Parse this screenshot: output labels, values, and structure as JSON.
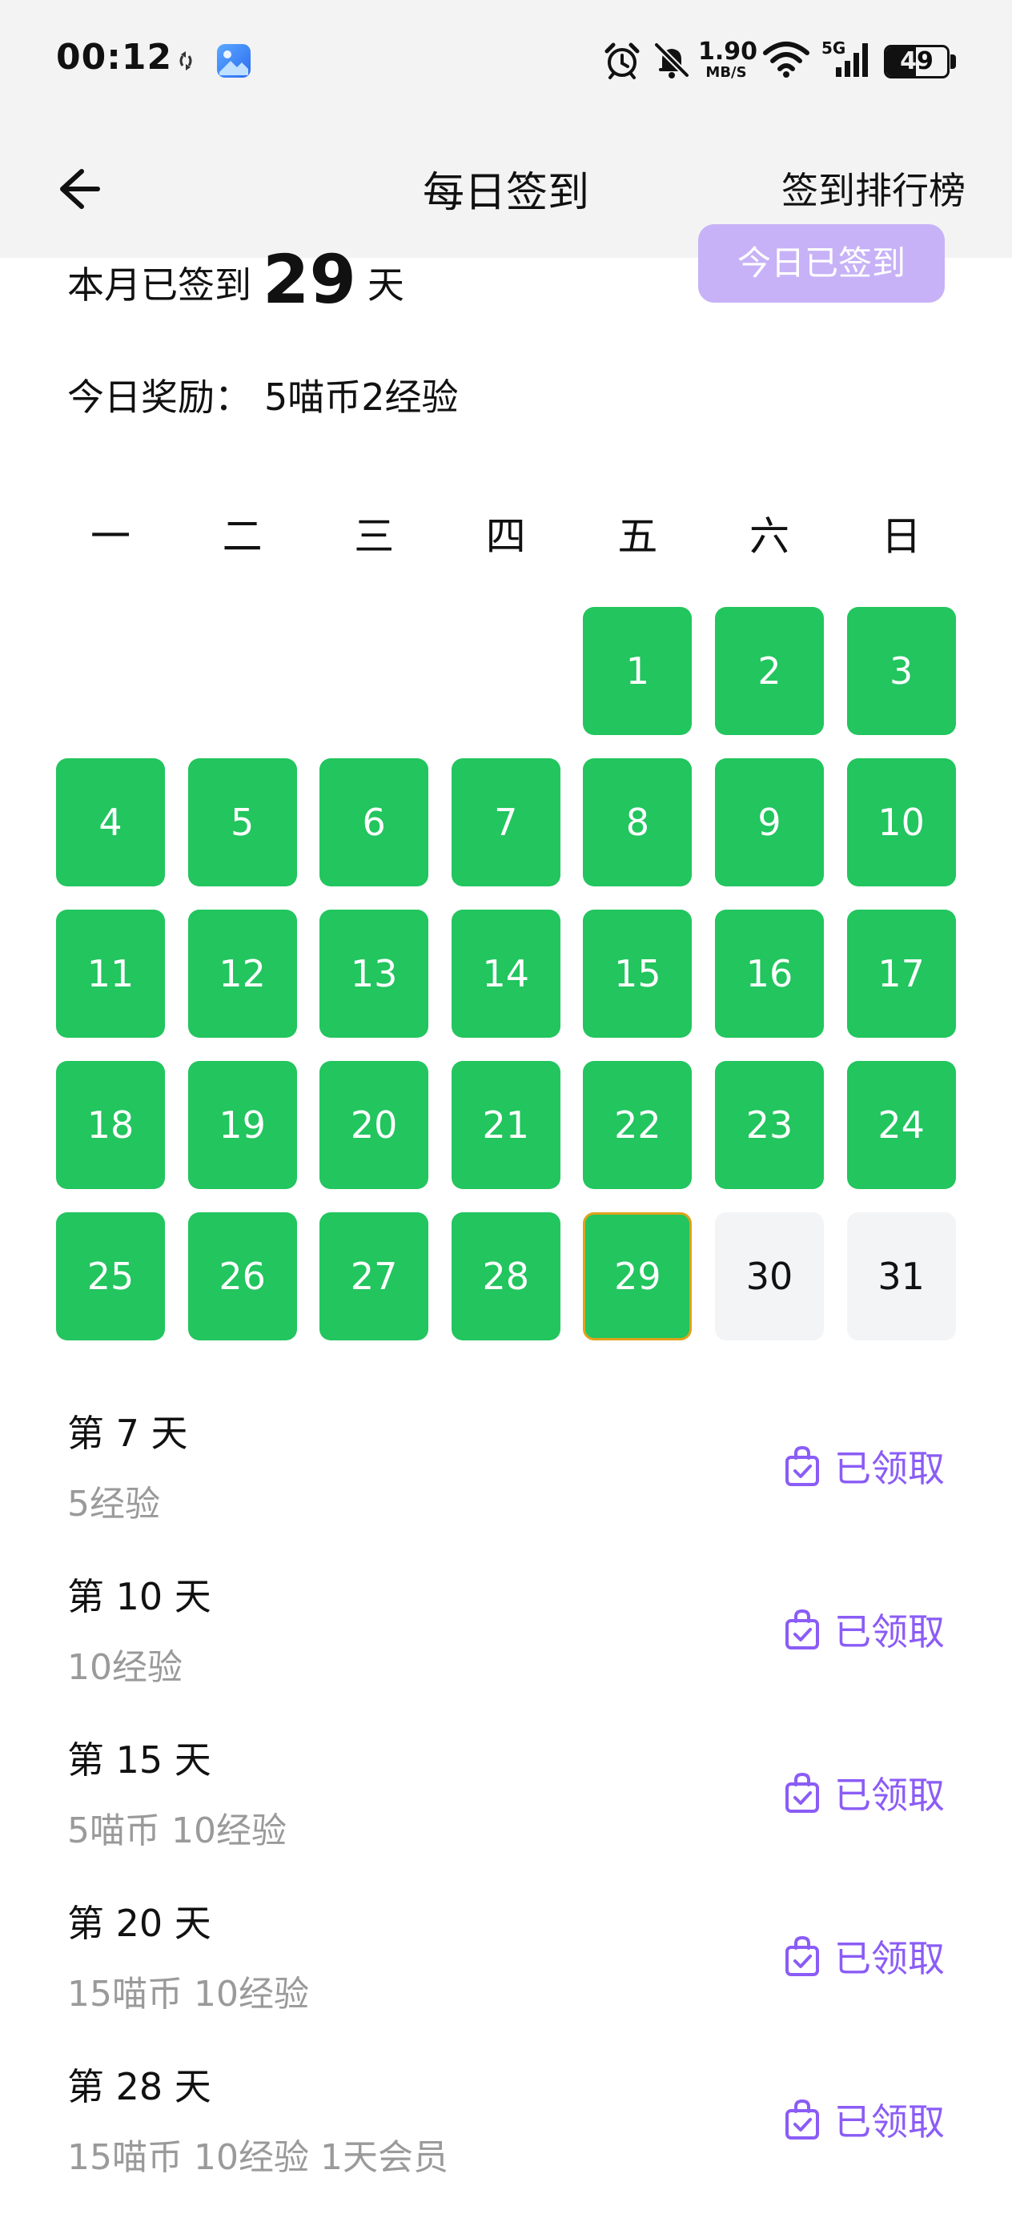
{
  "status_bar": {
    "time": "00:12",
    "net_speed_value": "1.90",
    "net_speed_unit": "MB/S",
    "network_type": "5G",
    "battery": "49",
    "battery_level": 0.49
  },
  "header": {
    "title": "每日签到",
    "ranking_label": "签到排行榜"
  },
  "summary": {
    "prefix": "本月已签到",
    "count": "29",
    "suffix": "天",
    "sign_button_label": "今日已签到",
    "reward_label": "今日奖励：",
    "reward_value": "5喵币2经验"
  },
  "calendar": {
    "weekdays": [
      "一",
      "二",
      "三",
      "四",
      "五",
      "六",
      "日"
    ],
    "first_weekday_index": 4,
    "days_in_month": 31,
    "signed_through": 29,
    "today": 29
  },
  "rewards": [
    {
      "day": "第 7 天",
      "desc": "5经验",
      "status": "已领取"
    },
    {
      "day": "第 10 天",
      "desc": "10经验",
      "status": "已领取"
    },
    {
      "day": "第 15 天",
      "desc": "5喵币 10经验",
      "status": "已领取"
    },
    {
      "day": "第 20 天",
      "desc": "15喵币 10经验",
      "status": "已领取"
    },
    {
      "day": "第 28 天",
      "desc": "15喵币 10经验 1天会员",
      "status": "已领取"
    }
  ],
  "colors": {
    "signed": "#22c55e",
    "future": "#f3f4f6",
    "today_border": "#e0a21a",
    "accent": "#8b5cf6",
    "button": "#c7b2f7"
  }
}
